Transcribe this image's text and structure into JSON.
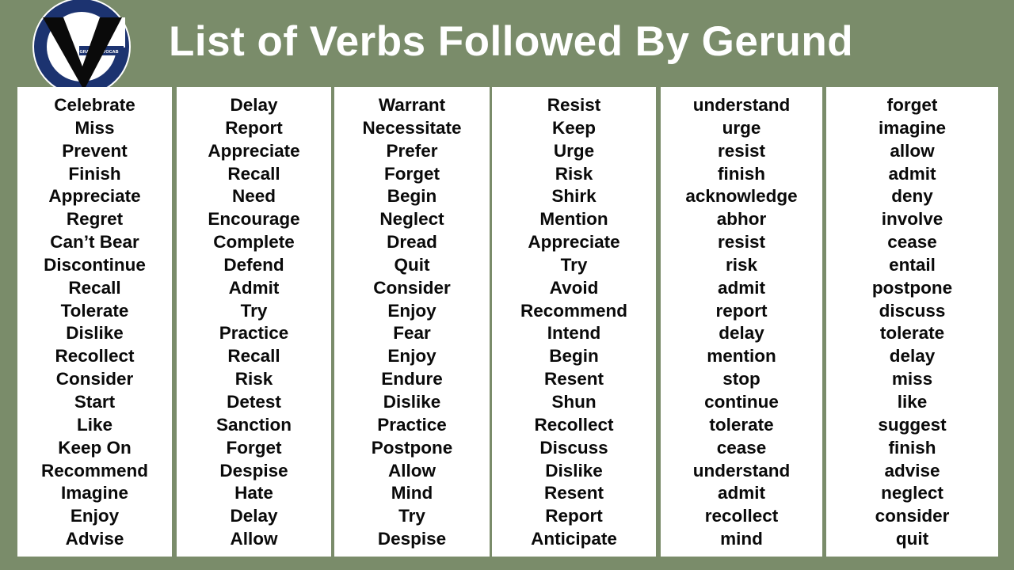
{
  "header": {
    "title": "List of Verbs Followed By Gerund",
    "logo_text": "GRAMMARVOCAB",
    "logo_icon": "grammarvocab-logo-icon"
  },
  "colors": {
    "background": "#7a8c6a",
    "panel": "#ffffff",
    "title_text": "#ffffff",
    "logo_ring": "#1c3370",
    "logo_v": "#0a0a0a"
  },
  "columns": [
    {
      "words": [
        "Celebrate",
        "Miss",
        "Prevent",
        "Finish",
        "Appreciate",
        "Regret",
        "Can’t Bear",
        "Discontinue",
        "Recall",
        "Tolerate",
        "Dislike",
        "Recollect",
        "Consider",
        "Start",
        "Like",
        "Keep On",
        "Recommend",
        "Imagine",
        "Enjoy",
        "Advise"
      ]
    },
    {
      "words": [
        "Delay",
        "Report",
        "Appreciate",
        "Recall",
        "Need",
        "Encourage",
        "Complete",
        "Defend",
        "Admit",
        "Try",
        "Practice",
        "Recall",
        "Risk",
        "Detest",
        "Sanction",
        "Forget",
        "Despise",
        "Hate",
        "Delay",
        "Allow"
      ]
    },
    {
      "words": [
        "Warrant",
        "Necessitate",
        "Prefer",
        "Forget",
        "Begin",
        "Neglect",
        "Dread",
        "Quit",
        "Consider",
        "Enjoy",
        "Fear",
        "Enjoy",
        "Endure",
        "Dislike",
        "Practice",
        "Postpone",
        "Allow",
        "Mind",
        "Try",
        "Despise"
      ]
    },
    {
      "words": [
        "Resist",
        "Keep",
        "Urge",
        "Risk",
        "Shirk",
        "Mention",
        "Appreciate",
        "Try",
        "Avoid",
        "Recommend",
        "Intend",
        "Begin",
        "Resent",
        "Shun",
        "Recollect",
        "Discuss",
        "Dislike",
        "Resent",
        "Report",
        "Anticipate"
      ]
    },
    {
      "words": [
        "understand",
        "urge",
        "resist",
        "finish",
        "acknowledge",
        "abhor",
        "resist",
        "risk",
        "admit",
        "report",
        "delay",
        "mention",
        "stop",
        "continue",
        "tolerate",
        "cease",
        "understand",
        "admit",
        "recollect",
        "mind"
      ]
    },
    {
      "words": [
        "forget",
        "imagine",
        "allow",
        "admit",
        "deny",
        "involve",
        "cease",
        "entail",
        "postpone",
        "discuss",
        "tolerate",
        "delay",
        "miss",
        "like",
        "suggest",
        "finish",
        "advise",
        "neglect",
        "consider",
        "quit"
      ]
    }
  ]
}
